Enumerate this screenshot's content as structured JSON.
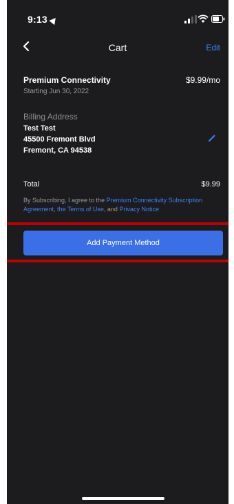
{
  "status_bar": {
    "time": "9:13"
  },
  "nav": {
    "title": "Cart",
    "edit_label": "Edit"
  },
  "product": {
    "name": "Premium Connectivity",
    "subtitle": "Starting Jun 30, 2022",
    "price": "$9.99/mo"
  },
  "billing": {
    "label": "Billing Address",
    "lines": [
      "Test Test",
      "45500 Fremont Blvd",
      "Fremont, CA 94538"
    ]
  },
  "total": {
    "label": "Total",
    "price": "$9.99"
  },
  "terms": {
    "prefix": "By Subscribing, I agree to the ",
    "link1": "Premium Connectivity Subscription Agreement",
    "sep1": ", ",
    "link2": "the Terms of Use",
    "sep2": ", and ",
    "link3": "Privacy Notice"
  },
  "pay_button_label": "Add Payment Method",
  "colors": {
    "background": "#1c1c1e",
    "accent": "#3b82f6",
    "button": "#3b6fe6",
    "highlight": "#c00000"
  }
}
